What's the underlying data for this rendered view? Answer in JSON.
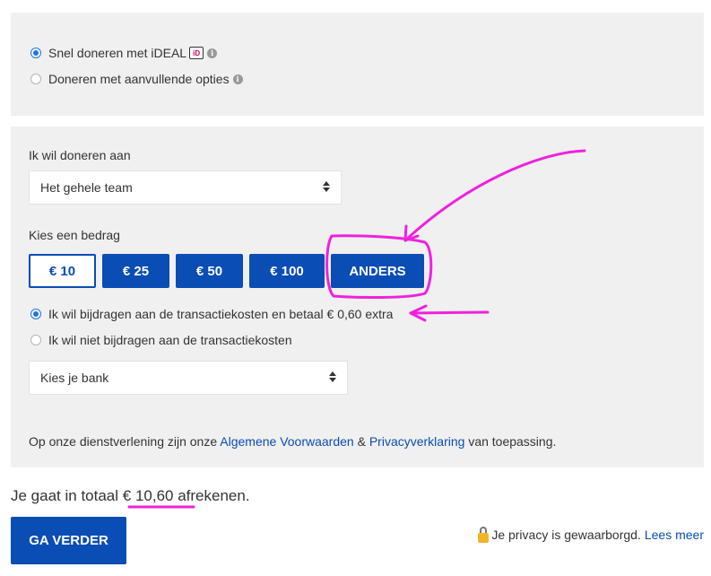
{
  "payment_method": {
    "options": [
      {
        "label": "Snel doneren met iDEAL",
        "selected": true,
        "icon": "ideal-icon"
      },
      {
        "label": "Doneren met aanvullende opties",
        "selected": false
      }
    ]
  },
  "donation": {
    "recipient_label": "Ik wil doneren aan",
    "recipient_value": "Het gehele team",
    "amount_label": "Kies een bedrag",
    "amounts": [
      "€ 10",
      "€ 25",
      "€ 50",
      "€ 100",
      "ANDERS"
    ],
    "selected_amount": "€ 10",
    "fee_options": [
      {
        "label": "Ik wil bijdragen aan de transactiekosten en betaal € 0,60 extra",
        "selected": true
      },
      {
        "label": "Ik wil niet bijdragen aan de transactiekosten",
        "selected": false
      }
    ],
    "bank_placeholder": "Kies je bank",
    "terms": {
      "prefix": "Op onze dienstverlening zijn onze",
      "link1": "Algemene Voorwaarden",
      "amp": "&",
      "link2": "Privacyverklaring",
      "suffix": "van toepassing."
    }
  },
  "footer": {
    "total_prefix": "Je gaat in totaal",
    "total_amount": "€ 10,60 afrekenen.",
    "go_button": "GA VERDER",
    "privacy_text": "Je privacy is gewaarborgd.",
    "privacy_link": "Lees meer"
  },
  "colors": {
    "accent": "#0a4db4",
    "annotation": "#ee22dd",
    "panel": "#f0f0f0"
  }
}
